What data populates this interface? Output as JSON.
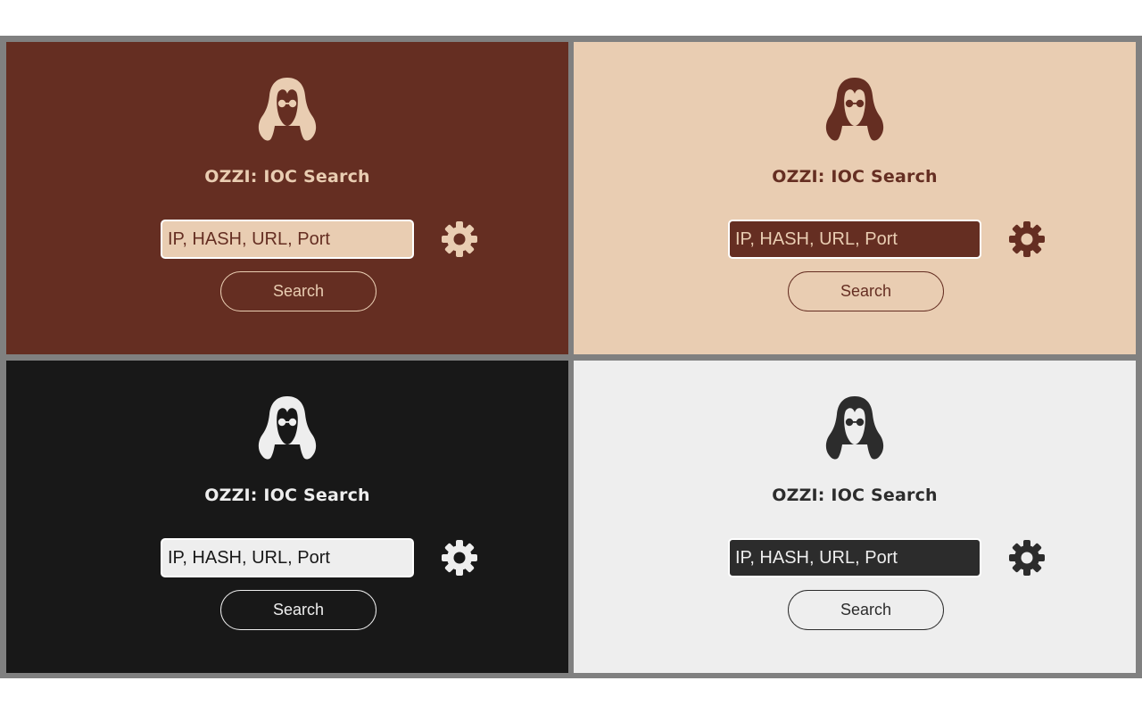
{
  "panels": [
    {
      "theme": "brown",
      "title": "OZZI: IOC Search",
      "search": {
        "placeholder": "IP, HASH, URL, Port",
        "value": ""
      },
      "button_label": "Search",
      "colors": {
        "background": "#652e22",
        "title": "#e9cdb2",
        "logo": "#e9cdb2",
        "input_bg": "#e9cdb2",
        "input_text": "#652e22",
        "gear": "#e9cdb2",
        "button_border": "#e9cdb2",
        "button_text": "#e9cdb2"
      },
      "icons": {
        "logo": "long-hair-sunglasses-avatar-icon",
        "settings": "gear-icon"
      }
    },
    {
      "theme": "tan",
      "title": "OZZI: IOC Search",
      "search": {
        "placeholder": "IP, HASH, URL, Port",
        "value": ""
      },
      "button_label": "Search",
      "colors": {
        "background": "#e9cdb2",
        "title": "#652e22",
        "logo": "#652e22",
        "input_bg": "#652e22",
        "input_text": "#e9cdb2",
        "gear": "#652e22",
        "button_border": "#652e22",
        "button_text": "#652e22"
      },
      "icons": {
        "logo": "long-hair-sunglasses-avatar-icon",
        "settings": "gear-icon"
      }
    },
    {
      "theme": "dark",
      "title": "OZZI: IOC Search",
      "search": {
        "placeholder": "IP, HASH, URL, Port",
        "value": ""
      },
      "button_label": "Search",
      "colors": {
        "background": "#181818",
        "title": "#eeeeee",
        "logo": "#eeeeee",
        "input_bg": "#eeeeee",
        "input_text": "#181818",
        "gear": "#eeeeee",
        "button_border": "#eeeeee",
        "button_text": "#eeeeee"
      },
      "icons": {
        "logo": "long-hair-sunglasses-avatar-icon",
        "settings": "gear-icon"
      }
    },
    {
      "theme": "light",
      "title": "OZZI: IOC Search",
      "search": {
        "placeholder": "IP, HASH, URL, Port",
        "value": ""
      },
      "button_label": "Search",
      "colors": {
        "background": "#eeeeee",
        "title": "#2c2c2c",
        "logo": "#2c2c2c",
        "input_bg": "#2c2c2c",
        "input_text": "#eeeeee",
        "gear": "#2c2c2c",
        "button_border": "#2c2c2c",
        "button_text": "#2c2c2c"
      },
      "icons": {
        "logo": "long-hair-sunglasses-avatar-icon",
        "settings": "gear-icon"
      }
    }
  ],
  "frame_color": "#808080"
}
